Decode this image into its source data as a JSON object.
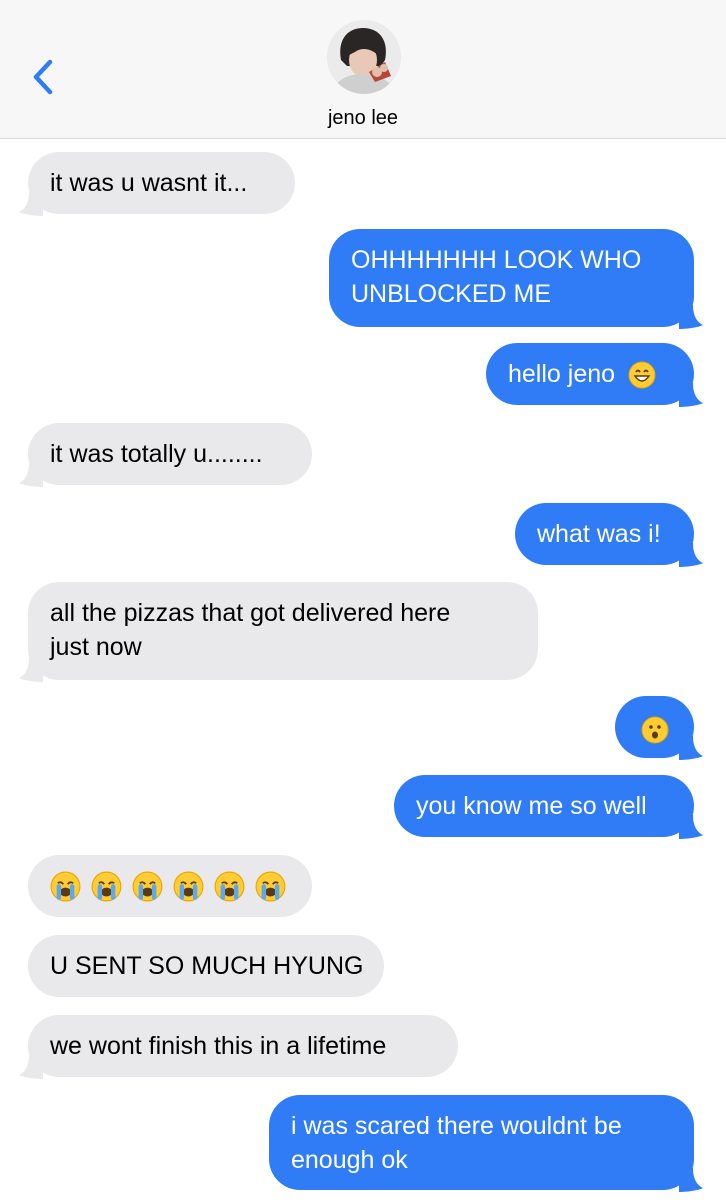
{
  "header": {
    "contact_name": "jeno lee",
    "back_icon": "chevron-left-icon",
    "accent": "#2f7cf6"
  },
  "colors": {
    "incoming_bubble": "#e9e9eb",
    "outgoing_bubble": "#2f7cf6",
    "header_bg": "#f7f7f7"
  },
  "messages": [
    {
      "from": "them",
      "text": "it was u wasnt it..."
    },
    {
      "from": "me",
      "lines": [
        "OHHHHHHH LOOK WHO",
        "UNBLOCKED ME"
      ]
    },
    {
      "from": "me",
      "text": "hello jeno",
      "emoji": "grinning-face-icon"
    },
    {
      "from": "them",
      "text": "it was totally u........"
    },
    {
      "from": "me",
      "text": "what was i!"
    },
    {
      "from": "them",
      "lines": [
        "all the pizzas that got delivered here",
        "just now"
      ]
    },
    {
      "from": "me",
      "emoji": "hushed-face-icon"
    },
    {
      "from": "me",
      "text": "you know me so well"
    },
    {
      "from": "them",
      "emoji": "loudly-crying-face-icon",
      "emoji_count": 6
    },
    {
      "from": "them",
      "text": "U SENT SO MUCH HYUNG"
    },
    {
      "from": "them",
      "text": "we wont finish this in a lifetime"
    },
    {
      "from": "me",
      "lines": [
        "i was scared there wouldnt be",
        "enough ok"
      ]
    }
  ]
}
